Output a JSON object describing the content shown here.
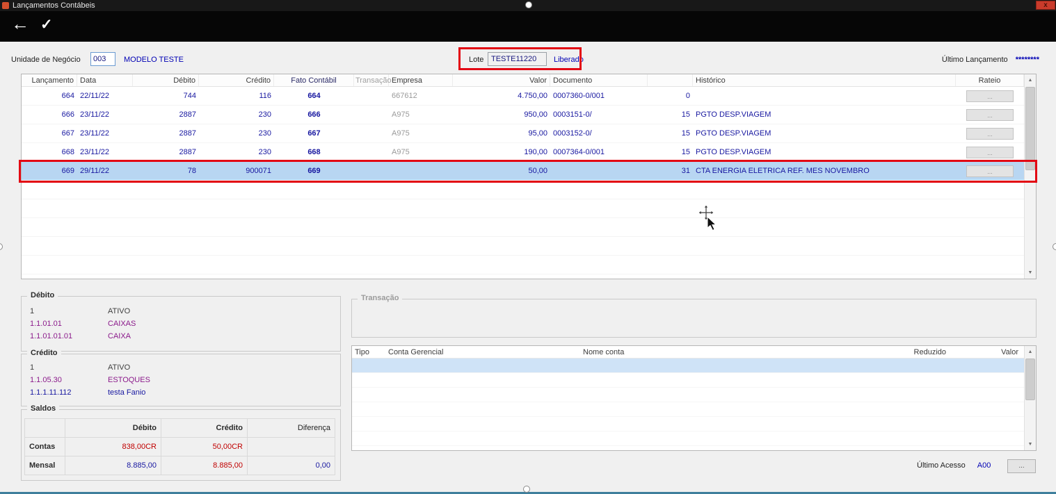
{
  "window": {
    "title": "Lançamentos Contábeis",
    "close": "x"
  },
  "toolbar": {
    "back": "←",
    "confirm": "✓"
  },
  "header": {
    "unit_label": "Unidade de Negócio",
    "unit_code": "003",
    "unit_name": "MODELO TESTE",
    "lote_label": "Lote",
    "lote_value": "TESTE11220",
    "lote_status": "Liberado",
    "last_entry_label": "Último Lançamento",
    "last_entry_value": "********"
  },
  "entries": {
    "columns": {
      "lancamento": "Lançamento",
      "data": "Data",
      "debito": "Débito",
      "credito": "Crédito",
      "fato": "Fato Contábil",
      "transacao": "Transação",
      "empresa": "Empresa",
      "valor": "Valor",
      "documento": "Documento",
      "historico": "Histórico",
      "rateio": "Rateio"
    },
    "rateio_button": "...",
    "rows": [
      {
        "lancamento": "664",
        "data": "22/11/22",
        "debito": "744",
        "credito": "116",
        "fato": "664",
        "transacao": "",
        "empresa": "667612",
        "valor": "4.750,00",
        "documento": "0007360-0/001",
        "hist_code": "0",
        "historico": "",
        "selected": false
      },
      {
        "lancamento": "666",
        "data": "23/11/22",
        "debito": "2887",
        "credito": "230",
        "fato": "666",
        "transacao": "",
        "empresa": "A975",
        "valor": "950,00",
        "documento": "0003151-0/",
        "hist_code": "15",
        "historico": "PGTO DESP.VIAGEM",
        "selected": false
      },
      {
        "lancamento": "667",
        "data": "23/11/22",
        "debito": "2887",
        "credito": "230",
        "fato": "667",
        "transacao": "",
        "empresa": "A975",
        "valor": "95,00",
        "documento": "0003152-0/",
        "hist_code": "15",
        "historico": "PGTO DESP.VIAGEM",
        "selected": false
      },
      {
        "lancamento": "668",
        "data": "23/11/22",
        "debito": "2887",
        "credito": "230",
        "fato": "668",
        "transacao": "",
        "empresa": "A975",
        "valor": "190,00",
        "documento": "0007364-0/001",
        "hist_code": "15",
        "historico": "PGTO DESP.VIAGEM",
        "selected": false
      },
      {
        "lancamento": "669",
        "data": "29/11/22",
        "debito": "78",
        "credito": "900071",
        "fato": "669",
        "transacao": "",
        "empresa": "",
        "valor": "50,00",
        "documento": "",
        "hist_code": "31",
        "historico": "CTA ENERGIA ELETRICA REF. MES NOVEMBRO",
        "selected": true
      }
    ]
  },
  "debit_box": {
    "title": "Débito",
    "rows": [
      {
        "code": "1",
        "name": "ATIVO",
        "color": "dark"
      },
      {
        "code": "1.1.01.01",
        "name": "CAIXAS",
        "color": "purple"
      },
      {
        "code": "1.1.01.01.01",
        "name": "CAIXA",
        "color": "purple"
      }
    ]
  },
  "credit_box": {
    "title": "Crédito",
    "rows": [
      {
        "code": "1",
        "name": "ATIVO",
        "color": "dark"
      },
      {
        "code": "1.1.05.30",
        "name": "ESTOQUES",
        "color": "purple"
      },
      {
        "code": "1.1.1.11.112",
        "name": "testa Fanio",
        "color": "navy"
      }
    ]
  },
  "saldos": {
    "title": "Saldos",
    "col_debito": "Débito",
    "col_credito": "Crédito",
    "col_diferenca": "Diferença",
    "rows": [
      {
        "label": "Contas",
        "debito": "838,00CR",
        "credito": "50,00CR",
        "diferenca": "",
        "debito_color": "red",
        "credito_color": "red",
        "diferenca_color": "navy"
      },
      {
        "label": "Mensal",
        "debito": "8.885,00",
        "credito": "8.885,00",
        "diferenca": "0,00",
        "debito_color": "navy",
        "credito_color": "red",
        "diferenca_color": "navy"
      }
    ]
  },
  "transacao_box": {
    "title": "Transação"
  },
  "detail_table": {
    "columns": [
      "Tipo",
      "Conta Gerencial",
      "Nome conta",
      "Reduzido",
      "Valor"
    ]
  },
  "footer": {
    "last_access_label": "Último Acesso",
    "last_access_value": "A00",
    "browse_button": "..."
  },
  "colors": {
    "navy": "#1717a0",
    "purple": "#8b1a8b",
    "red": "#c00000",
    "annotation": "#e30613",
    "selection": "#b8d6f2"
  }
}
